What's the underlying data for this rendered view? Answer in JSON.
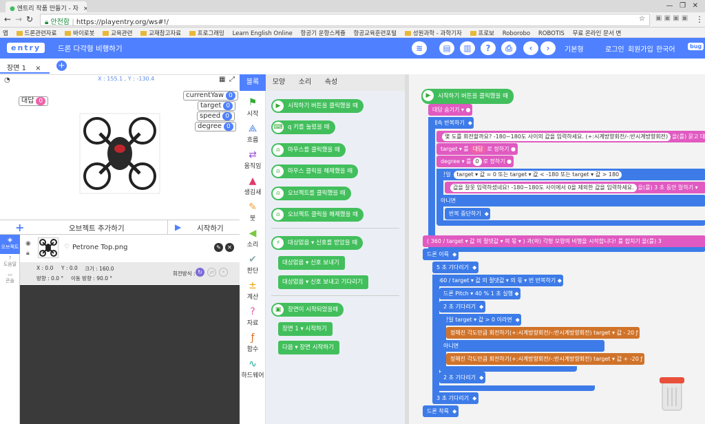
{
  "browser": {
    "tab_title": "엔트리 작품 만들기 - 자",
    "secure_label": "안전함",
    "url": "https://playentry.org/ws#!/",
    "bookmarks": [
      "앱",
      "드론관련자료",
      "바이로봇",
      "교육관련",
      "교재참고자료",
      "프로그래밍",
      "Learn English Online",
      "항공기 운항스케쥴",
      "항공교육훈련포털",
      "성원과학 - 과학기자",
      "프로보",
      "Roborobo",
      "ROBOTIS",
      "무료 온라인 문서 변"
    ]
  },
  "topbar": {
    "logo": "entry",
    "project_title": "드론 다각형 비행하기",
    "mode": "기본형",
    "login": "로그인",
    "signup": "회원가입",
    "language": "한국어",
    "bug": "bug"
  },
  "scene": {
    "tab_label": "장면 1"
  },
  "stage": {
    "coords": "X : 155.1 , Y : -130.4",
    "answer_label": "대답",
    "answer_value": "0",
    "variables": [
      {
        "name": "currentYaw",
        "value": "0"
      },
      {
        "name": "target",
        "value": "0"
      },
      {
        "name": "speed",
        "value": "0"
      },
      {
        "name": "degree",
        "value": "0"
      }
    ]
  },
  "object_panel": {
    "add_object": "오브젝트 추가하기",
    "start": "시작하기",
    "side_tabs": [
      "오브젝트",
      "도움말",
      "콘솔"
    ],
    "object_name": "Petrone Top.png",
    "x": "X : 0.0",
    "y": "Y : 0.0",
    "size": "크기 : 160.0",
    "direction": "방향 : 0.0 °",
    "move_direction": "이동 방향 : 90.0 °",
    "rotation_mode": "회전방식 :"
  },
  "block_tabs": [
    "블록",
    "모양",
    "소리",
    "속성"
  ],
  "categories": [
    "시작",
    "흐름",
    "움직임",
    "생김새",
    "붓",
    "소리",
    "판단",
    "계산",
    "자료",
    "함수",
    "하드웨어"
  ],
  "palette": [
    "시작하기 버튼을 클릭했을 때",
    "q 키를 눌렀을 때",
    "마우스를 클릭했을 때",
    "마우스 클릭을 해제했을 때",
    "오브젝트를 클릭했을 때",
    "오브젝트 클릭을 해제했을 때",
    "대상없음 ▾ 신호를 받았을 때",
    "대상없음 ▾ 신호 보내기",
    "대상없음 ▾ 신호 보내고 기다리기",
    "장면이 시작되었을때",
    "장면 1 ▾ 시작하기",
    "다음 ▾ 장면 시작하기"
  ],
  "script": {
    "start": "시작하기 버튼을 클릭했을 때",
    "hide_answer": "대답 숨기기 ▾",
    "forever": "계속 반복하기",
    "ask": "몇 도를 회전할까요? -180~180도 사이의 값을 입력하세요. (+:시계방향회전/-:반시계방향회전)",
    "ask_tail": "을(를) 묻고 대답 기다리기",
    "set_target_pre": "target ▾ 를",
    "set_target_val": "대답",
    "set_target_post": "로 정하기",
    "set_degree_pre": "degree ▾ 를",
    "set_degree_val": "0",
    "set_degree_post": "로 정하기",
    "if_label": "만일",
    "if_cond": "target ▾ 값 = 0 또는 target ▾ 값 < -180 또는 target ▾ 값 > 180",
    "say": "값을 잘못 입력하셨네요! -180~180도 사이에서 0을 제외한 값을 입력하세요.",
    "say_tail": "을(를) 3 초 동안 말하기 ▾",
    "else_label": "아니면",
    "stop_repeat": "반복 중단하기",
    "say2": "( 360 / target ▾ 값 의 절댓값 ▾ 의 몫 ▾ ) 과(와) 각형 모양의 비행을 시작합니다! 를 합치기 을(를) 3",
    "takeoff": "드론 이륙",
    "wait5": "5 초 기다리기",
    "repeat_n": "360 / target ▾ 값 의 절댓값 ▾ 의 몫 ▾ 번 반복하기",
    "pitch": "드론 Pitch ▾ 40 % 1 초 실행",
    "wait2a": "2 초 기다리기",
    "if2": "만일 target ▾ 값 > 0 이라면",
    "rotate1": "정해진 각도만큼 회전하기(+:시계방향회전/-:반시계방향회전)  target ▾ 값 - 20",
    "else2": "아니면",
    "rotate2": "정해진 각도만큼 회전하기(+:시계방향회전/-:반시계방향회전)  target ▾ 값 + -20",
    "wait2b": "2 초 기다리기",
    "wait3": "3 초 기다리기",
    "land": "드론 착륙"
  },
  "colors": {
    "accent": "#4f80ff",
    "start": "#42bf5c",
    "flow": "#3d7be8",
    "looks": "#e05ac1"
  }
}
